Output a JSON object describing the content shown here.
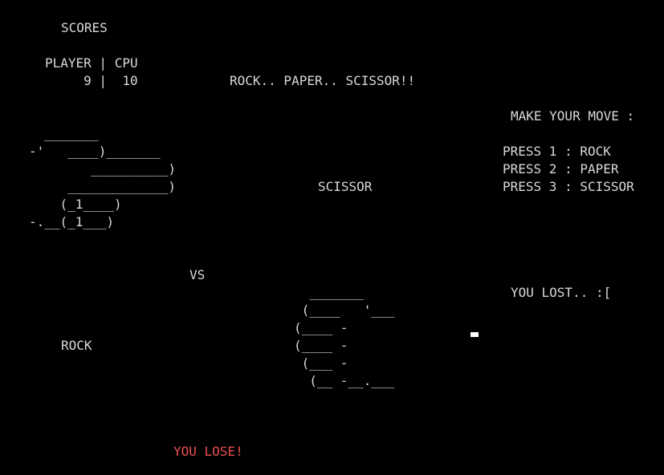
{
  "scores": {
    "heading": "SCORES",
    "header_row": "PLAYER | CPU",
    "values_row": "     9 |  10"
  },
  "title": "ROCK.. PAPER.. SCISSOR!!",
  "instructions": {
    "heading": "MAKE YOUR MOVE :",
    "options": [
      "PRESS 1 : ROCK",
      "PRESS 2 : PAPER",
      "PRESS 3 : SCISSOR"
    ]
  },
  "player": {
    "choice_label": "ROCK",
    "art": "  _______\n-'   ____)_______\n        __________)\n     _____________)\n    (_1____)\n-.__(_1___)"
  },
  "cpu": {
    "choice_label": "SCISSOR",
    "art": "  _______\n (____   '___\n(____ -\n(____ -\n (___ -\n  (__ -__.___"
  },
  "versus_label": "VS",
  "status_message": "YOU LOST.. :[",
  "result_banner": "YOU LOSE!",
  "colors": {
    "background": "#000000",
    "text": "#d9d9d9",
    "result": "#e8514f",
    "cursor": "#ffffff"
  }
}
